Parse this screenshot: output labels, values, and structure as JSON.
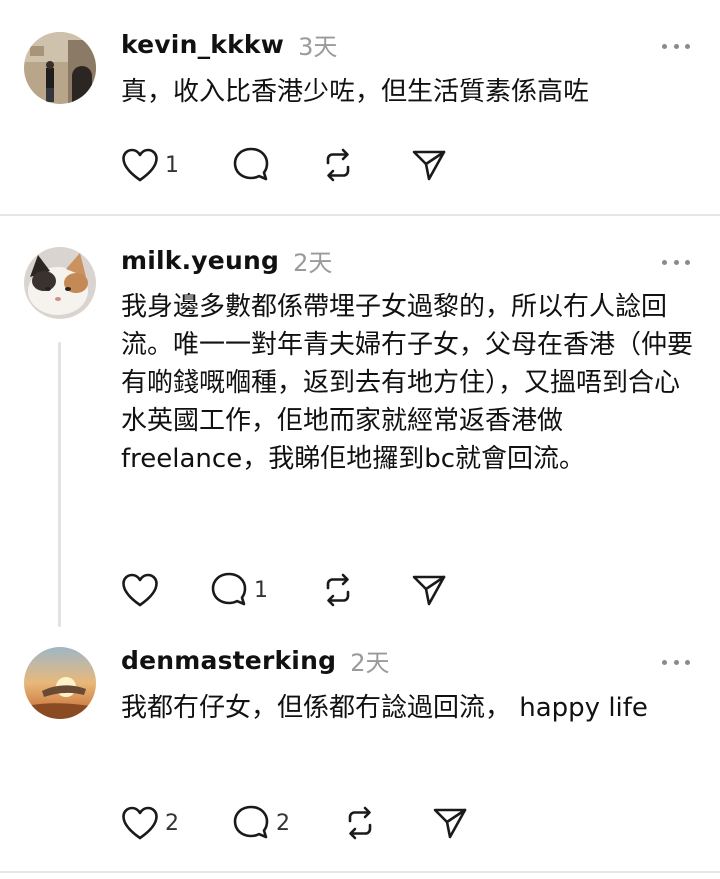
{
  "posts": [
    {
      "username": "kevin_kkkw",
      "time": "3天",
      "text": "真，收入比香港少咗，但生活質素係高咗",
      "likes": "1",
      "replies": "",
      "avatar_icon": "user-photo-icon"
    },
    {
      "username": "milk.yeung",
      "time": "2天",
      "text": "我身邊多數都係帶埋子女過黎的，所以冇人諗回流。唯一一對年青夫婦冇子女，父母在香港（仲要有啲錢嘅嗰種，返到去有地方住），又搵唔到合心水英國工作，佢地而家就經常返香港做freelance，我睇佢地攞到bc就會回流。",
      "likes": "",
      "replies": "1",
      "avatar_icon": "cat-photo-icon"
    },
    {
      "username": "denmasterking",
      "time": "2天",
      "text": "我都冇仔女，但係都冇諗過回流， happy life",
      "likes": "2",
      "replies": "2",
      "avatar_icon": "sunset-photo-icon"
    }
  ],
  "icons": {
    "like": "heart-icon",
    "reply": "comment-bubble-icon",
    "repost": "repost-arrows-icon",
    "share": "paper-plane-icon",
    "more": "more-dots-icon"
  }
}
